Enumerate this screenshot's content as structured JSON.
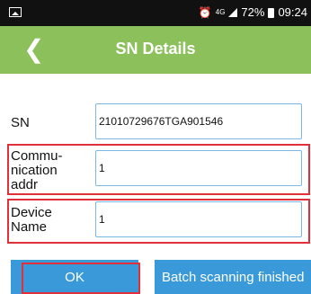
{
  "status_bar": {
    "battery": "72%",
    "time": "09:24",
    "network": "4G"
  },
  "header": {
    "title": "SN Details"
  },
  "form": {
    "sn_label": "SN",
    "sn_value": "21010729676TGA901546",
    "comm_label": "Commu-\nnication\naddr",
    "comm_value": "1",
    "device_label": "Device\nName",
    "device_value": "1"
  },
  "buttons": {
    "ok_label": "OK",
    "batch_label": "Batch scanning finished"
  },
  "colors": {
    "header": "#8bc05a",
    "button": "#3a9ad9",
    "highlight": "#e0303a",
    "field_border": "#7cb8e6"
  }
}
